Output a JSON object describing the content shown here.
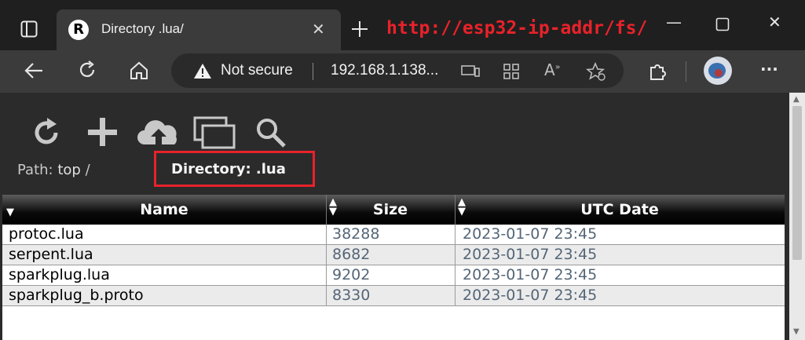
{
  "browser": {
    "tab_title": "Directory .lua/",
    "annotation": "http://esp32-ip-addr/fs/",
    "security_label": "Not secure",
    "url": "192.168.1.138..."
  },
  "page": {
    "path_label": "Path:",
    "path_value": "top",
    "path_sep": "/",
    "directory_label": "Directory: .lua",
    "table": {
      "headers": [
        "Name",
        "Size",
        "UTC Date"
      ],
      "rows": [
        [
          "protoc.lua",
          "38288",
          "2023-01-07 23:45"
        ],
        [
          "serpent.lua",
          "8682",
          "2023-01-07 23:45"
        ],
        [
          "sparkplug.lua",
          "9202",
          "2023-01-07 23:45"
        ],
        [
          "sparkplug_b.proto",
          "8330",
          "2023-01-07 23:45"
        ]
      ]
    }
  },
  "icons": [
    "sidebar-icon",
    "favicon",
    "close-icon",
    "new-tab-icon",
    "minimize-icon",
    "maximize-icon",
    "window-close-icon",
    "back-icon",
    "refresh-icon",
    "home-icon",
    "warning-icon",
    "app-available-icon",
    "qr-icon",
    "read-aloud-icon",
    "favorites-icon",
    "extensions-icon",
    "profile-icon",
    "more-icon",
    "reload-icon",
    "new-file-icon",
    "upload-icon",
    "copy-icon",
    "search-icon"
  ]
}
